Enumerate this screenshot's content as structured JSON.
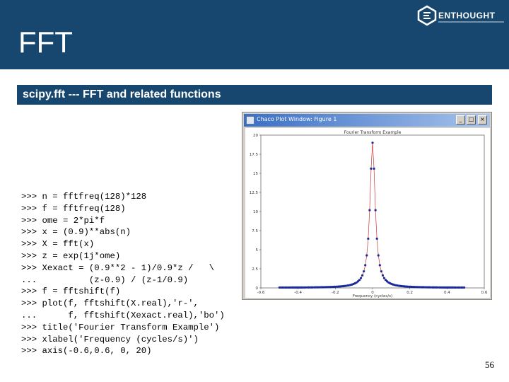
{
  "slide": {
    "title": "FFT",
    "section_title": "scipy.fft --- FFT and related functions",
    "page_number": "56",
    "logo_text": "ENTHOUGHT"
  },
  "code": [
    ">>> n = fftfreq(128)*128",
    ">>> f = fftfreq(128)",
    ">>> ome = 2*pi*f",
    ">>> x = (0.9)**abs(n)",
    ">>> X = fft(x)",
    ">>> z = exp(1j*ome)",
    ">>> Xexact = (0.9**2 - 1)/0.9*z /   \\",
    "...          (z-0.9) / (z-1/0.9)",
    ">>> f = fftshift(f)",
    ">>> plot(f, fftshift(X.real),'r-',",
    "...      f, fftshift(Xexact.real),'bo')",
    ">>> title('Fourier Transform Example')",
    ">>> xlabel('Frequency (cycles/s)')",
    ">>> axis(-0.6,0.6, 0, 20)"
  ],
  "window": {
    "title": "Chaco Plot Window: Figure 1",
    "buttons": [
      "_",
      "□",
      "×"
    ]
  },
  "chart_data": {
    "type": "line",
    "title": "Fourier Transform Example",
    "xlabel": "Frequency (cycles/s)",
    "ylabel": "",
    "xlim": [
      -0.6,
      0.6
    ],
    "ylim": [
      0,
      20
    ],
    "xticks": [
      "-0.6",
      "-0.4",
      "-0.2",
      "0",
      "0.2",
      "0.4",
      "0.6"
    ],
    "yticks": [
      "0",
      "2.5",
      "5",
      "7.5",
      "10",
      "12.5",
      "15",
      "17.5",
      "20"
    ],
    "series": [
      {
        "style": "red-line",
        "color": "#cc3333",
        "formula": "(0.9**2 - 1)/0.9*z/((z-0.9)*(z-1/0.9)), z = exp(2j*pi*f)"
      },
      {
        "style": "blue-dots",
        "color": "#1a2a99",
        "formula": "(0.9**2 - 1)/0.9*z/((z-0.9)*(z-1/0.9)), z = exp(2j*pi*f)"
      }
    ],
    "sample_spacing": 0.0078125,
    "grid": false,
    "legend": "none"
  }
}
